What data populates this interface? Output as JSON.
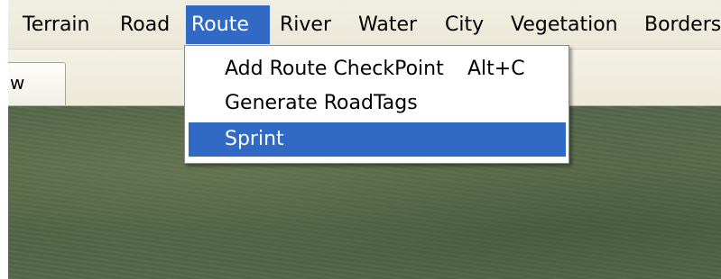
{
  "menubar": {
    "items": [
      {
        "label": "Terrain"
      },
      {
        "label": "Road"
      },
      {
        "label": "Route",
        "active": true
      },
      {
        "label": "River"
      },
      {
        "label": "Water"
      },
      {
        "label": "City"
      },
      {
        "label": "Vegetation"
      },
      {
        "label": "Borders"
      }
    ]
  },
  "tab": {
    "label": "w"
  },
  "route_menu": {
    "items": [
      {
        "label": "Add Route CheckPoint",
        "shortcut": "Alt+C"
      },
      {
        "label": "Generate RoadTags",
        "shortcut": ""
      },
      {
        "label": "Sprint",
        "shortcut": "",
        "selected": true
      }
    ]
  },
  "colors": {
    "menu_highlight": "#316ac5",
    "menubar_bg": "#ece9d8",
    "terrain": "#55684a"
  }
}
